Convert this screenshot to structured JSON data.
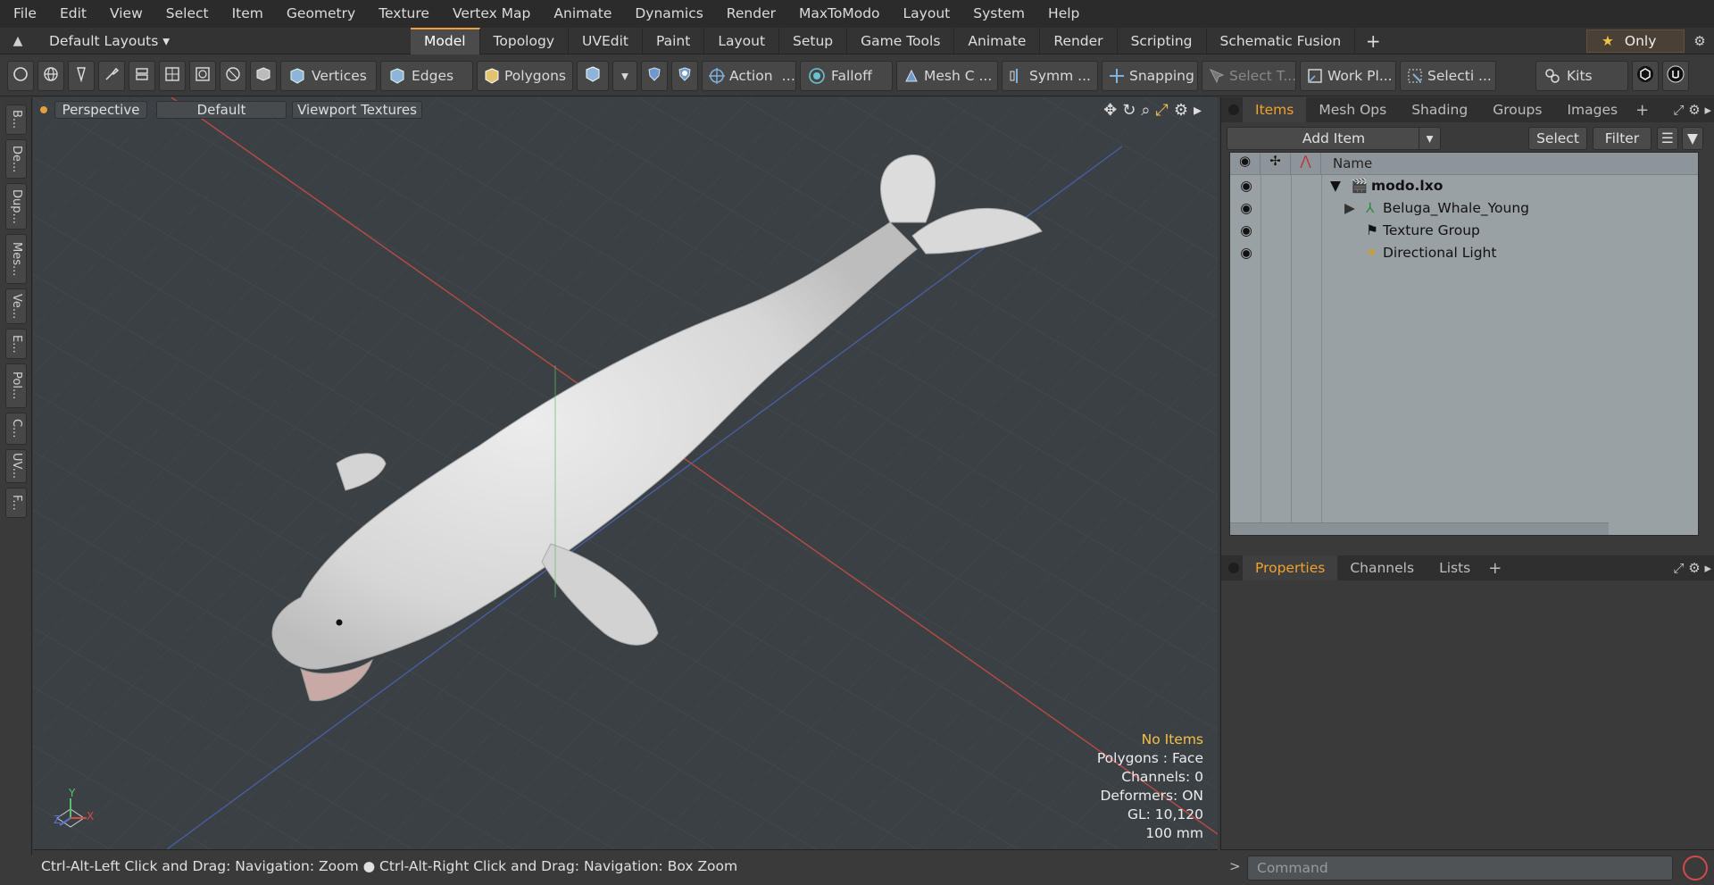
{
  "menu": [
    "File",
    "Edit",
    "View",
    "Select",
    "Item",
    "Geometry",
    "Texture",
    "Vertex Map",
    "Animate",
    "Dynamics",
    "Render",
    "MaxToModo",
    "Layout",
    "System",
    "Help"
  ],
  "layouts_dropdown": "Default Layouts",
  "tabs": [
    "Model",
    "Topology",
    "UVEdit",
    "Paint",
    "Layout",
    "Setup",
    "Game Tools",
    "Animate",
    "Render",
    "Scripting",
    "Schematic Fusion"
  ],
  "active_tab": "Model",
  "only_label": "Only",
  "toolbar": {
    "vertices": "Vertices",
    "edges": "Edges",
    "polygons": "Polygons",
    "action": "Action",
    "falloff": "Falloff",
    "mesh": "Mesh C ...",
    "symm": "Symm ...",
    "snapping": "Snapping",
    "select_t": "Select T...",
    "work_pl": "Work Pl...",
    "selecti": "Selecti ...",
    "kits": "Kits"
  },
  "left_tabs": [
    "B...",
    "De...",
    "Dup...",
    "Mes...",
    "Ve...",
    "E...",
    "Pol...",
    "C...",
    "UV...",
    "F..."
  ],
  "viewport": {
    "view": "Perspective",
    "shading": "Default",
    "textures": "Viewport Textures",
    "info": {
      "no_items": "No Items",
      "polygons": "Polygons : Face",
      "channels": "Channels: 0",
      "deformers": "Deformers: ON",
      "gl": "GL: 10,120",
      "scale": "100 mm"
    },
    "axis": {
      "y": "Y",
      "x": "X",
      "z": "Z"
    }
  },
  "status": "Ctrl-Alt-Left Click and Drag: Navigation: Zoom ● Ctrl-Alt-Right Click and Drag: Navigation: Box Zoom",
  "items_panel": {
    "tabs": [
      "Items",
      "Mesh Ops",
      "Shading",
      "Groups",
      "Images"
    ],
    "active": "Items",
    "add_item": "Add Item",
    "select": "Select",
    "filter": "Filter",
    "name_col": "Name",
    "rows": [
      {
        "label": "modo.lxo"
      },
      {
        "label": "Beluga_Whale_Young"
      },
      {
        "label": "Texture Group"
      },
      {
        "label": "Directional Light"
      }
    ]
  },
  "properties_panel": {
    "tabs": [
      "Properties",
      "Channels",
      "Lists"
    ],
    "active": "Properties"
  },
  "command_placeholder": "Command",
  "colors": {
    "accent": "#e7a23a",
    "viewport_bg": "#3b4044",
    "tree_bg": "#9aa1a5"
  }
}
